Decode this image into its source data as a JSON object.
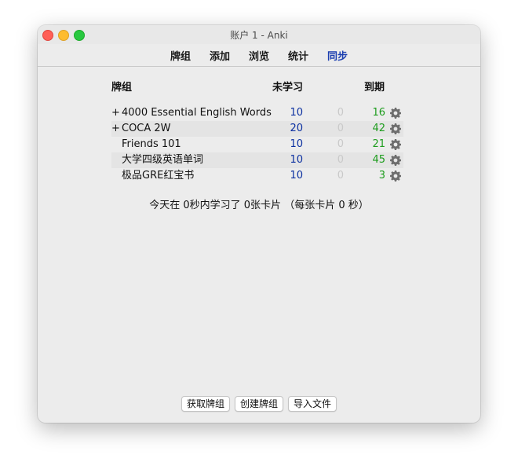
{
  "window": {
    "title": "账户 1 - Anki"
  },
  "toolbar": {
    "tabs": [
      {
        "label": "牌组",
        "active": false
      },
      {
        "label": "添加",
        "active": false
      },
      {
        "label": "浏览",
        "active": false
      },
      {
        "label": "统计",
        "active": false
      },
      {
        "label": "同步",
        "active": true
      }
    ]
  },
  "deck_list": {
    "headers": {
      "deck": "牌组",
      "new": "未学习",
      "due": "到期"
    },
    "decks": [
      {
        "expander": "+",
        "name": "4000 Essential English Words",
        "new": "10",
        "learn": "0",
        "due": "16"
      },
      {
        "expander": "+",
        "name": "COCA 2W",
        "new": "20",
        "learn": "0",
        "due": "42"
      },
      {
        "expander": "",
        "name": "Friends 101",
        "new": "10",
        "learn": "0",
        "due": "21"
      },
      {
        "expander": "",
        "name": "大学四级英语单词",
        "new": "10",
        "learn": "0",
        "due": "45"
      },
      {
        "expander": "",
        "name": "极品GRE红宝书",
        "new": "10",
        "learn": "0",
        "due": "3"
      }
    ]
  },
  "summary": "今天在 0秒内学习了 0张卡片 （每张卡片 0 秒）",
  "buttons": {
    "get_shared": "获取牌组",
    "create_deck": "创建牌组",
    "import_file": "导入文件"
  },
  "colors": {
    "new_count": "#0a2fa0",
    "due_count": "#1f9d1f",
    "learn_count": "#c9c9c9",
    "active_tab": "#1c3fb0"
  },
  "icons": {
    "deck_options": "gear-icon"
  }
}
